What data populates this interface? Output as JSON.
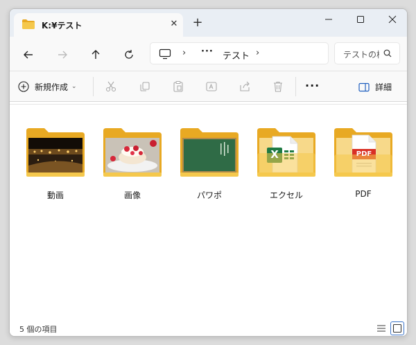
{
  "tab": {
    "title": "K:¥テスト",
    "close_icon": "close-icon"
  },
  "window_controls": [
    "minimize",
    "maximize",
    "close"
  ],
  "address": {
    "crumb": "テスト"
  },
  "search": {
    "placeholder": "テストの検索"
  },
  "toolbar": {
    "new_label": "新規作成",
    "details_label": "詳細"
  },
  "items": [
    {
      "name": "動画",
      "thumb": "video"
    },
    {
      "name": "画像",
      "thumb": "image"
    },
    {
      "name": "パワポ",
      "thumb": "powerpoint"
    },
    {
      "name": "エクセル",
      "thumb": "excel"
    },
    {
      "name": "PDF",
      "thumb": "pdf"
    }
  ],
  "pdf_badge": "PDF",
  "excel_badge": "X",
  "status": {
    "count": "5 個の項目"
  },
  "colors": {
    "folder": "#f5c84c",
    "folder_back": "#e8a923",
    "excel": "#1f7a43",
    "pdf": "#d93025",
    "accent": "#3b74c9"
  }
}
